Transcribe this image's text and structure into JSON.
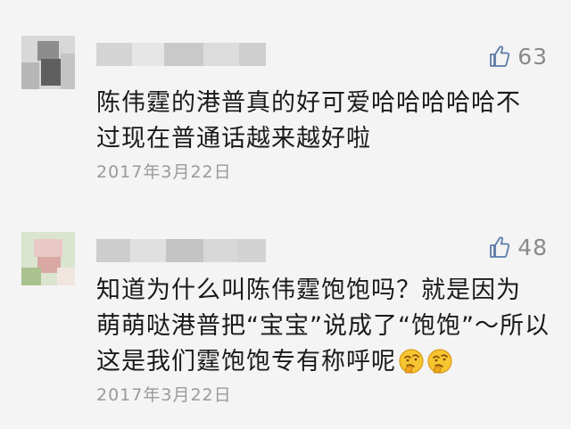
{
  "comments": [
    {
      "text_lines": [
        "陈伟霆的港普真的好可爱哈哈哈哈哈不",
        "过现在普通话越来越好啦"
      ],
      "date": "2017年3月22日",
      "likes": "63",
      "avatar_colors": [
        "#cfcfcf",
        "#8d8d8d",
        "#5f5f5f",
        "#b7b7b7",
        "#e2e2e2"
      ],
      "username_blocks": [
        "#d4d4d4",
        "#bcbcbc",
        "#dcdcdc",
        "#c6c6c6",
        "#d9d9d9"
      ]
    },
    {
      "text_lines": [
        "知道为什么叫陈伟霆饱饱吗？就是因为",
        "萌萌哒港普把“宝宝”说成了“饱饱”～所以",
        "这是我们霆饱饱专有称呼呢"
      ],
      "date": "2017年3月22日",
      "likes": "48",
      "emoji": [
        "thinking-face-icon",
        "thinking-face-icon"
      ],
      "avatar_colors": [
        "#cfdcc0",
        "#e8c9c3",
        "#d9a8a2",
        "#a9c28f",
        "#f1e6df"
      ],
      "username_blocks": [
        "#cdcdcd",
        "#bfbfbf",
        "#d8d8d8",
        "#c4c4c4",
        "#d3d3d3"
      ]
    }
  ],
  "colors": {
    "background": "#f4f4f4",
    "text": "#1a1a1a",
    "meta": "#9a9a9a",
    "like_icon": "#5b7ba8"
  }
}
